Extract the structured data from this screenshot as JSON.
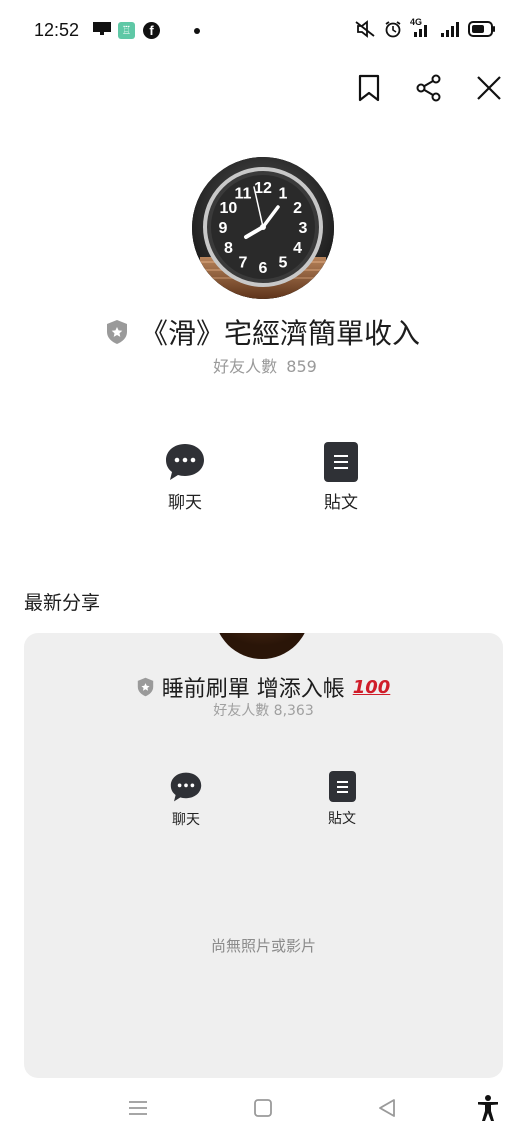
{
  "status_bar": {
    "time": "12:52",
    "left_icons": [
      "monitor-icon",
      "app-icon",
      "facebook-icon",
      "dot-icon"
    ],
    "right_icons": [
      "mute-icon",
      "alarm-icon",
      "signal-4g-icon",
      "signal-icon",
      "battery-icon"
    ],
    "fb_glyph": "f",
    "app_glyph": "♖",
    "net_label": "4G"
  },
  "top_actions": {
    "icons": [
      "bookmark-icon",
      "share-icon",
      "close-icon"
    ]
  },
  "profile": {
    "name": "《滑》宅經濟簡單收入",
    "friends_label": "好友人數",
    "friends_count": "859",
    "clock_numbers": [
      "12",
      "1",
      "2",
      "3",
      "4",
      "5",
      "6",
      "7",
      "8",
      "9",
      "10",
      "11"
    ]
  },
  "actions": {
    "chat_label": "聊天",
    "post_label": "貼文"
  },
  "latest": {
    "title": "最新分享",
    "card": {
      "name": "睡前刷單 增添入帳",
      "badge": "100",
      "friends_label": "好友人數",
      "friends_count": "8,363",
      "chat_label": "聊天",
      "post_label": "貼文",
      "empty_text": "尚無照片或影片"
    }
  },
  "nav": {
    "icons": [
      "menu-icon",
      "home-icon",
      "back-icon",
      "accessibility-icon"
    ]
  },
  "colors": {
    "accent_dark": "#2f3136",
    "card_bg": "#efefef",
    "muted_text": "#9a9a9a",
    "badge_red": "#d01d2a"
  }
}
